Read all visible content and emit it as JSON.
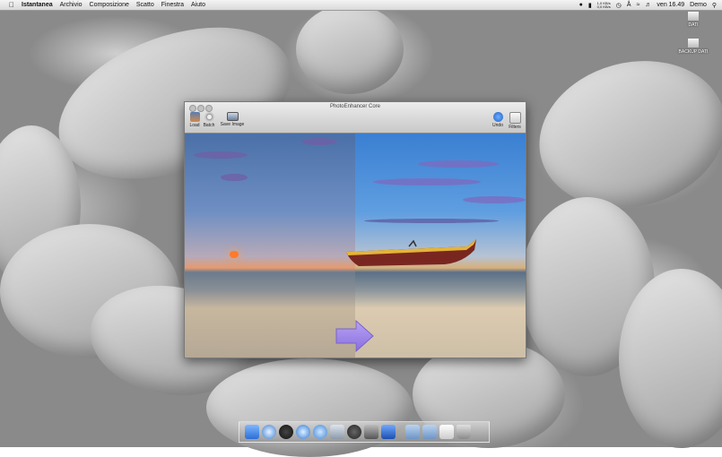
{
  "menubar": {
    "app_name": "Istantanea",
    "items": [
      "Archivio",
      "Composizione",
      "Scatto",
      "Finestra",
      "Aiuto"
    ],
    "status_top": "1,0 KB/s",
    "status_bottom": "0,0 KB/s",
    "clock": "ven 16.49",
    "user": "Demo"
  },
  "desktop_icons": [
    {
      "label": "DATI"
    },
    {
      "label": "BACKUP DATI"
    }
  ],
  "window": {
    "title": "PhotoEnhancer Core",
    "toolbar_left": [
      {
        "label": "Load",
        "icon": "photo-icon"
      },
      {
        "label": "Batch",
        "icon": "gear-icon"
      },
      {
        "label": "Save Image",
        "icon": "monitor-icon"
      }
    ],
    "toolbar_right": [
      {
        "label": "Undo",
        "icon": "undo-icon"
      },
      {
        "label": "Filters",
        "icon": "filters-icon"
      }
    ]
  },
  "dock": {
    "icons": [
      "finder-icon",
      "mail-icon",
      "dashboard-icon",
      "safari-icon",
      "itunes-icon",
      "preview-icon",
      "camera-icon",
      "photo-icon",
      "xcode-icon",
      "folder-icon",
      "folder-icon",
      "document-icon",
      "trash-icon"
    ]
  },
  "colors": {
    "accent": "#3a7fd2",
    "arrow": "#9a80e8",
    "boat_hull": "#7a2620",
    "boat_trim": "#e3b43a"
  }
}
